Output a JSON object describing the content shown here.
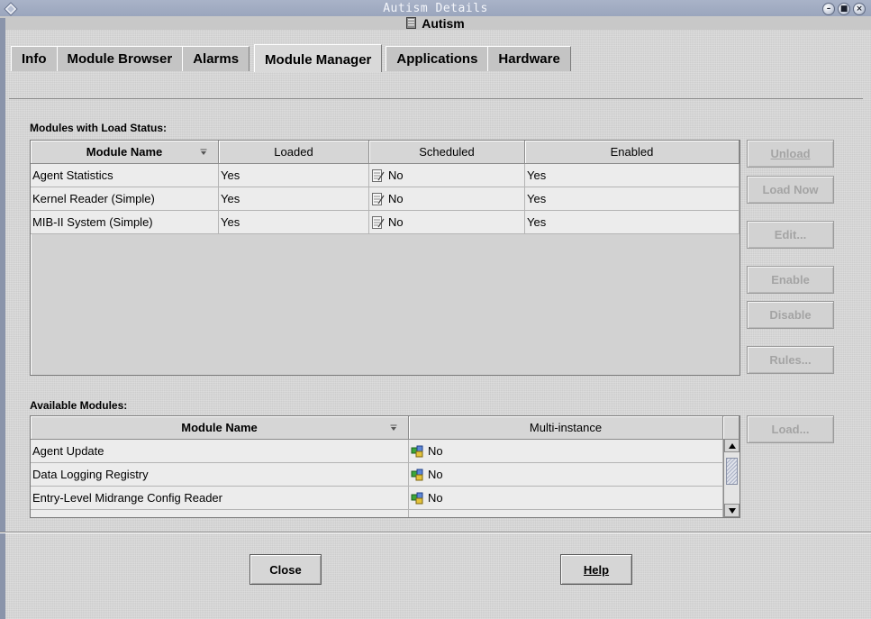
{
  "window": {
    "title": "Autism Details",
    "host_name": "Autism",
    "controls": [
      "minimize",
      "maximize",
      "close"
    ]
  },
  "tabs": [
    {
      "label": "Info",
      "active": false
    },
    {
      "label": "Module Browser",
      "active": false
    },
    {
      "label": "Alarms",
      "active": false
    },
    {
      "label": "Module Manager",
      "active": true
    },
    {
      "label": "Applications",
      "active": false
    },
    {
      "label": "Hardware",
      "active": false
    }
  ],
  "loaded_section": {
    "label": "Modules with Load Status:",
    "columns": [
      "Module Name",
      "Loaded",
      "Scheduled",
      "Enabled"
    ],
    "rows": [
      {
        "name": "Agent Statistics",
        "loaded": "Yes",
        "scheduled": "No",
        "enabled": "Yes"
      },
      {
        "name": "Kernel Reader (Simple)",
        "loaded": "Yes",
        "scheduled": "No",
        "enabled": "Yes"
      },
      {
        "name": "MIB-II System (Simple)",
        "loaded": "Yes",
        "scheduled": "No",
        "enabled": "Yes"
      }
    ],
    "buttons": {
      "unload": "Unload",
      "load_now": "Load Now",
      "edit": "Edit...",
      "enable": "Enable",
      "disable": "Disable",
      "rules": "Rules..."
    }
  },
  "available_section": {
    "label": "Available Modules:",
    "columns": [
      "Module Name",
      "Multi-instance"
    ],
    "rows": [
      {
        "name": "Agent Update",
        "multi_instance": "No"
      },
      {
        "name": "Data Logging Registry",
        "multi_instance": "No"
      },
      {
        "name": "Entry-Level Midrange Config Reader",
        "multi_instance": "No"
      }
    ],
    "buttons": {
      "load": "Load..."
    }
  },
  "dialog_buttons": {
    "close": "Close",
    "help": "Help"
  },
  "colors": {
    "titlebar": "#9aa5bd",
    "disabled_text": "#a4a4a4",
    "cell_bg": "#ececec"
  }
}
